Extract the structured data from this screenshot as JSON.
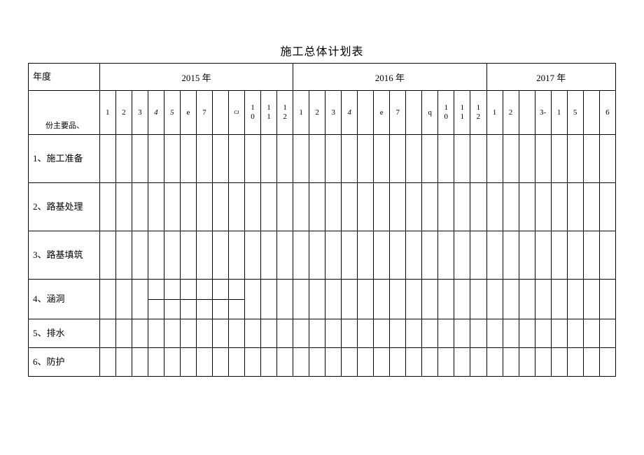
{
  "title": "施工总体计划表",
  "header": {
    "yearLabel": "年度",
    "years": [
      "2015 年",
      "2016 年",
      "2017 年"
    ],
    "monthLabel": "份主要品、",
    "months2015": [
      "1",
      "2",
      "3",
      "4",
      "5",
      "e",
      "7",
      "",
      "ᴄᴊ",
      "1\n0",
      "1\n1",
      "1\n2"
    ],
    "months2016": [
      "1",
      "2",
      "3",
      "4",
      "",
      "e",
      "7",
      "",
      "q",
      "1\n0",
      "1\n1",
      "1\n2"
    ],
    "months2017": [
      "1",
      "2",
      "",
      "3-",
      "1",
      "5",
      "",
      "6"
    ]
  },
  "rows": [
    "1、施工准备",
    "2、路基处理",
    "3、路基填筑",
    "4、涵洞",
    "5、排水",
    "6、防护"
  ]
}
